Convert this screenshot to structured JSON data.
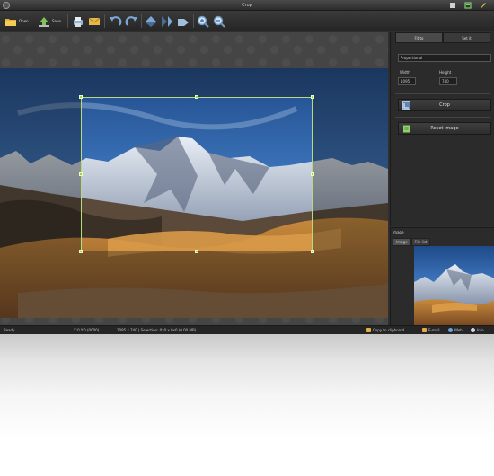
{
  "window": {
    "title": "Crop"
  },
  "toolbar": {
    "open_label": "Open",
    "save_label": "Save"
  },
  "panel": {
    "tabs": [
      "Fit to",
      "Set it"
    ],
    "aspect_value": "Proportional",
    "width_label": "Width",
    "height_label": "Height",
    "width_value": "1095",
    "height_value": "740",
    "crop_button": "Crop",
    "reset_button": "Reset Image"
  },
  "image_panel": {
    "header": "Image",
    "tabs": [
      "Image",
      "File list"
    ]
  },
  "status": {
    "ready": "Ready",
    "coords": "X:0 Y:0 (0000)",
    "info": "1095 x 740  |  Selection: 0x0 x 0x0 (0.00 MB)",
    "copy_clipboard": "Copy to clipboard",
    "email": "E-mail",
    "web": "Web",
    "info_btn": "Info"
  },
  "colors": {
    "app_bg": "#2f2f2f",
    "canvas_bg": "#454545",
    "crop_accent": "#9fd14b"
  }
}
